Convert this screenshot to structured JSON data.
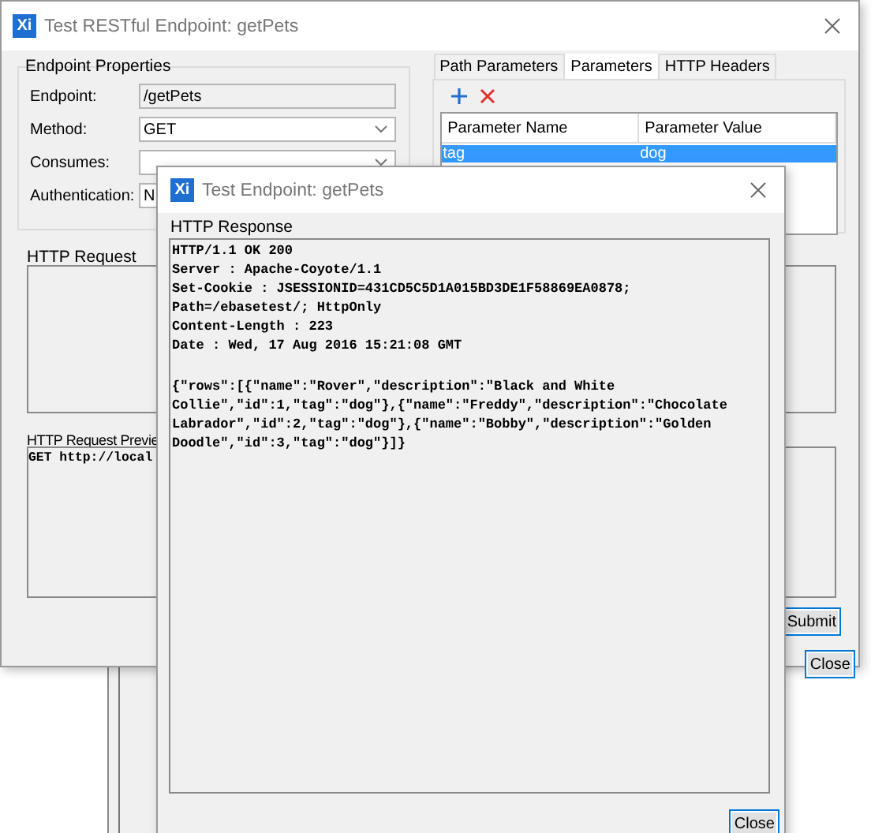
{
  "main_window": {
    "icon_text": "Xi",
    "title": "Test RESTful Endpoint: getPets",
    "endpoint_properties": {
      "title": "Endpoint Properties",
      "fields": [
        {
          "label": "Endpoint:",
          "value": "/getPets",
          "kind": "readonly"
        },
        {
          "label": "Method:",
          "value": "GET",
          "kind": "dropdown"
        },
        {
          "label": "Consumes:",
          "kind": "dropdown"
        },
        {
          "label": "Authentication:",
          "value": "N",
          "kind": "field"
        }
      ]
    },
    "tabs": [
      {
        "label": "Path Parameters",
        "selected": false
      },
      {
        "label": "Parameters",
        "selected": true
      },
      {
        "label": "HTTP Headers",
        "selected": false
      }
    ],
    "parameters_table": {
      "columns": [
        "Parameter Name",
        "Parameter Value"
      ],
      "rows": [
        {
          "cells": [
            "tag",
            "dog"
          ],
          "selected": true
        }
      ]
    },
    "http_request": {
      "title": "HTTP Request"
    },
    "http_request_preview": {
      "title": "HTTP Request Previe",
      "text": "GET http://local"
    },
    "buttons": [
      "Submit",
      "Close"
    ]
  },
  "dialog": {
    "icon_text": "Xi",
    "title": "Test Endpoint: getPets",
    "response": {
      "title": "HTTP Response",
      "header_lines": [
        "HTTP/1.1 OK 200",
        "Server : Apache-Coyote/1.1",
        "Set-Cookie : JSESSIONID=431CD5C5D1A015BD3DE1F58869EA0878;",
        "Path=/ebasetest/; HttpOnly",
        "Content-Length : 223",
        "Date : Wed, 17 Aug 2016 15:21:08 GMT"
      ],
      "body_lines": [
        "{\"rows\":[{\"name\":\"Rover\",\"description\":\"Black and White",
        "Collie\",\"id\":1,\"tag\":\"dog\"},{\"name\":\"Freddy\",\"description\":\"Chocolate",
        "Labrador\",\"id\":2,\"tag\":\"dog\"},{\"name\":\"Bobby\",\"description\":\"Golden",
        "Doodle\",\"id\":3,\"tag\":\"dog\"}]}"
      ]
    },
    "buttons": [
      "Close"
    ]
  }
}
